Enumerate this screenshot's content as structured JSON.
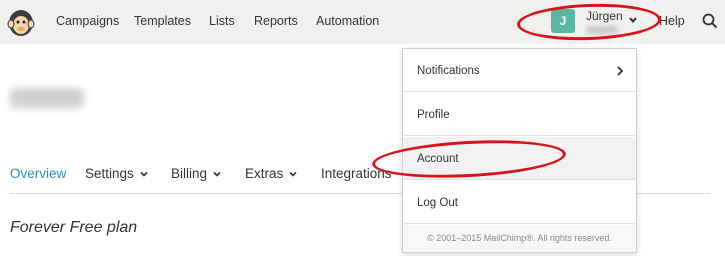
{
  "nav": {
    "items": [
      "Campaigns",
      "Templates",
      "Lists",
      "Reports",
      "Automation"
    ],
    "help": "Help"
  },
  "user": {
    "initial": "J",
    "name": "Jürgen"
  },
  "tabs": [
    "Overview",
    "Settings",
    "Billing",
    "Extras",
    "Integrations"
  ],
  "plan": "Forever Free plan",
  "dropdown": {
    "items": [
      "Notifications",
      "Profile",
      "Account",
      "Log Out"
    ],
    "footer": "© 2001–2015 MailChimp®. All rights reserved."
  },
  "colors": {
    "topbar": "#f0f0ef",
    "avatar": "#5cb4a2",
    "active_tab": "#2b8fb8",
    "annotation": "#d7141a"
  },
  "icons": [
    "mailchimp-logo",
    "chevron-down-icon",
    "search-icon",
    "chevron-right-icon"
  ]
}
